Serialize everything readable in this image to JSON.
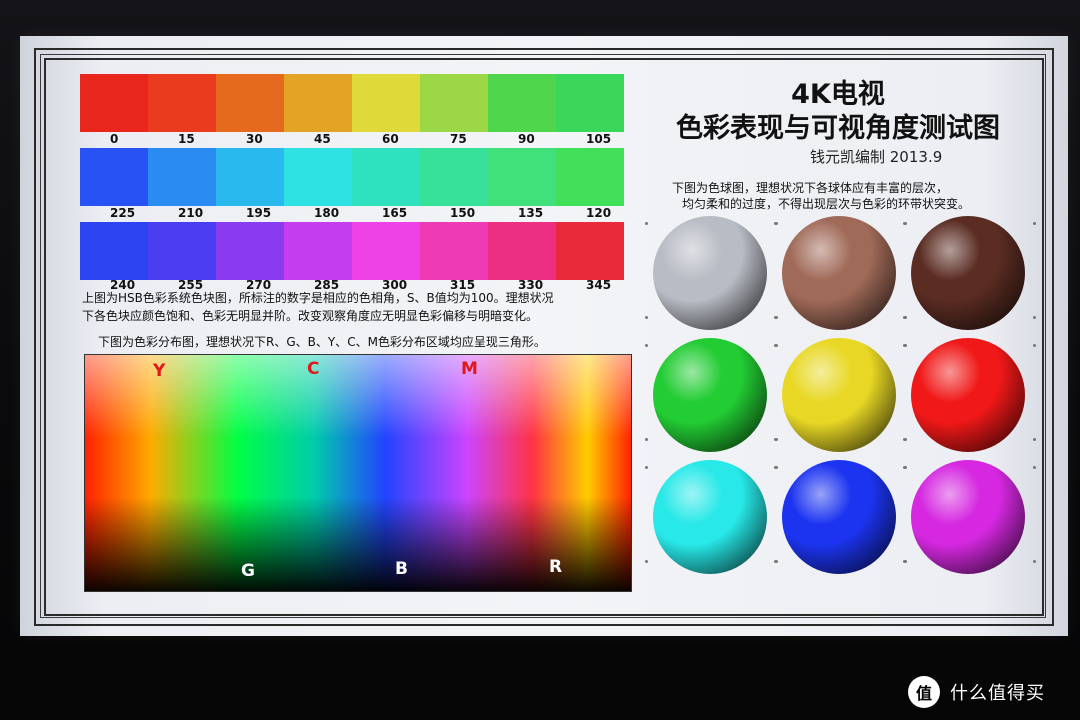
{
  "hsb_rows": [
    {
      "labels": [
        "0",
        "15",
        "30",
        "45",
        "60",
        "75",
        "90",
        "105"
      ],
      "colors": [
        "#e8261c",
        "#ea3b1e",
        "#e66a1e",
        "#e3a426",
        "#dfd93a",
        "#9cd845",
        "#4fd64c",
        "#3ad75a"
      ]
    },
    {
      "labels": [
        "225",
        "210",
        "195",
        "180",
        "165",
        "150",
        "135",
        "120"
      ],
      "colors": [
        "#2853f2",
        "#2a8cf0",
        "#29b9ef",
        "#2ee1e2",
        "#2ee2c0",
        "#37e199",
        "#40e07a",
        "#42e05a"
      ]
    },
    {
      "labels": [
        "240",
        "255",
        "270",
        "285",
        "300",
        "315",
        "330",
        "345"
      ],
      "colors": [
        "#2b43f0",
        "#4a3cf1",
        "#8a3bf0",
        "#c43ef0",
        "#ee42e6",
        "#ee3ab4",
        "#ec2f82",
        "#e82a3a"
      ]
    }
  ],
  "note_hsb_1": "上图为HSB色彩系统色块图，所标注的数字是相应的色相角，S、B值均为100。理想状况",
  "note_hsb_2": "下各色块应颜色饱和、色彩无明显并阶。改变观察角度应无明显色彩偏移与明暗变化。",
  "note_dist": "下图为色彩分布图，理想状况下R、G、B、Y、C、M色彩分布区域均应呈现三角形。",
  "dist_labels": {
    "Y": {
      "text": "Y",
      "color": "#e01818"
    },
    "C": {
      "text": "C",
      "color": "#e01818"
    },
    "M": {
      "text": "M",
      "color": "#e01818"
    },
    "G": {
      "text": "G",
      "color": "#ffffff"
    },
    "B": {
      "text": "B",
      "color": "#ffffff"
    },
    "R": {
      "text": "R",
      "color": "#ffffff"
    }
  },
  "title_line1": "4K电视",
  "title_line2": "色彩表现与可视角度测试图",
  "author": "钱元凯编制  2013.9",
  "note_sphere_1": "下图为色球图，理想状况下各球体应有丰富的层次，",
  "note_sphere_2": "均匀柔和的过度，不得出现层次与色彩的环带状突变。",
  "spheres": [
    {
      "name": "gray",
      "color": "#b8bcc4"
    },
    {
      "name": "light-brown",
      "color": "#a06a58"
    },
    {
      "name": "dark-brown",
      "color": "#5a2c22"
    },
    {
      "name": "green",
      "color": "#22cc33"
    },
    {
      "name": "yellow",
      "color": "#e8d825"
    },
    {
      "name": "red",
      "color": "#f01818"
    },
    {
      "name": "cyan",
      "color": "#28e8e8"
    },
    {
      "name": "blue",
      "color": "#1c34f0"
    },
    {
      "name": "magenta",
      "color": "#d528e0"
    }
  ],
  "watermark": {
    "badge": "值",
    "text": "什么值得买"
  }
}
